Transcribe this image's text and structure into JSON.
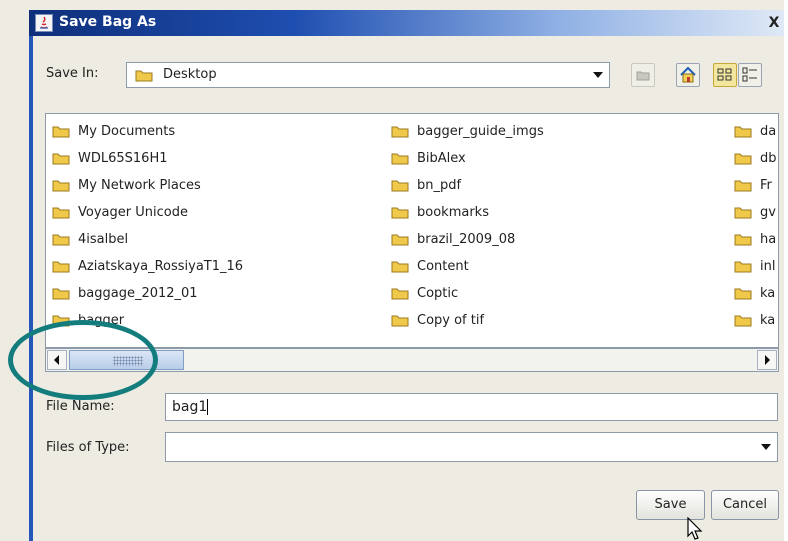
{
  "dialog": {
    "title": "Save Bag As",
    "close_label": "X"
  },
  "save_in": {
    "label": "Save In:",
    "value": "Desktop"
  },
  "toolbar": {
    "icons": [
      "up-folder-icon",
      "home-icon",
      "list-view-icon",
      "details-view-icon"
    ]
  },
  "files": {
    "columns": [
      [
        "My Documents",
        "WDL65S16H1",
        "My Network Places",
        "Voyager Unicode",
        "4isalbel",
        "Aziatskaya_RossiyaT1_16",
        "baggage_2012_01",
        "bagger"
      ],
      [
        "bagger_guide_imgs",
        "BibAlex",
        "bn_pdf",
        "bookmarks",
        "brazil_2009_08",
        "Content",
        "Coptic",
        "Copy of tif"
      ],
      [
        "da",
        "db",
        "Fr",
        "gv",
        "ha",
        "inl",
        "ka",
        "ka"
      ]
    ]
  },
  "file_name": {
    "label": "File Name:",
    "value": "bag1"
  },
  "files_of_type": {
    "label": "Files of Type:",
    "value": ""
  },
  "buttons": {
    "save": "Save",
    "cancel": "Cancel"
  },
  "colors": {
    "title_bar": "#1e4eb0",
    "highlight_oval": "#137c7c",
    "folder": "#f0c84a"
  }
}
